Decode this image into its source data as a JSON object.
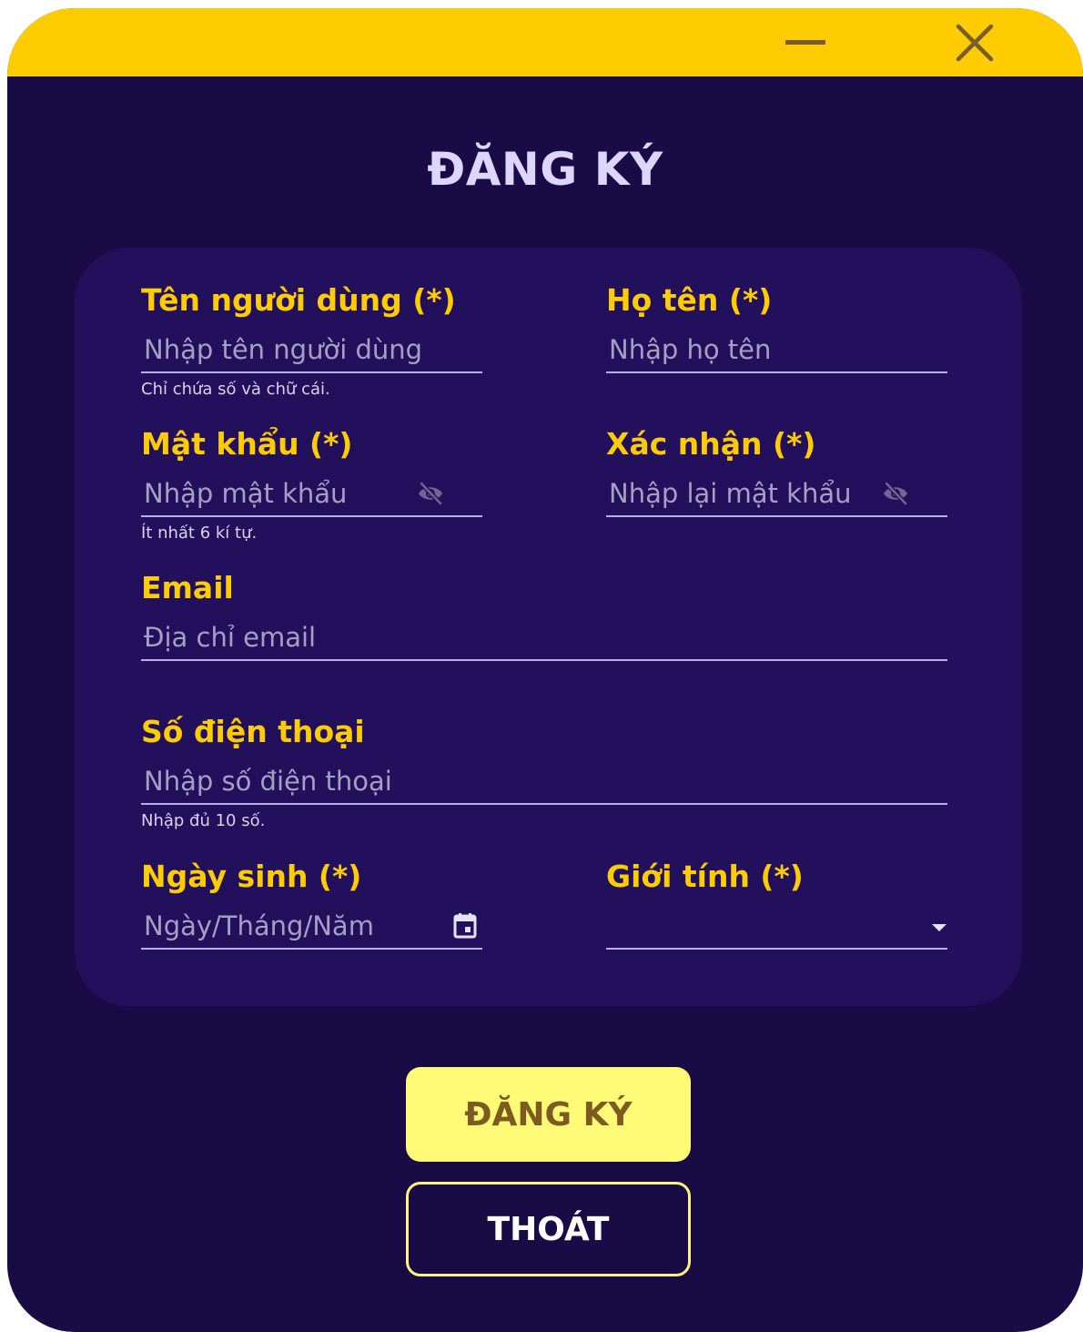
{
  "window": {
    "minimize_icon": "minimize-icon",
    "close_icon": "close-icon"
  },
  "form": {
    "title": "ĐĂNG KÝ",
    "username": {
      "label": "Tên người dùng (*)",
      "placeholder": "Nhập tên người dùng",
      "helper": "Chỉ chứa số và chữ cái."
    },
    "fullname": {
      "label": "Họ tên (*)",
      "placeholder": "Nhập họ tên"
    },
    "password": {
      "label": "Mật khẩu (*)",
      "placeholder": "Nhập mật khẩu",
      "helper": "Ít nhất 6 kí tự.",
      "icon": "eye-off-icon"
    },
    "confirm": {
      "label": "Xác nhận (*)",
      "placeholder": "Nhập lại mật khẩu",
      "icon": "eye-off-icon"
    },
    "email": {
      "label": "Email",
      "placeholder": "Địa chỉ email"
    },
    "phone": {
      "label": "Số điện thoại",
      "placeholder": "Nhập số điện thoại",
      "helper": "Nhập đủ 10 số."
    },
    "birthday": {
      "label": "Ngày sinh (*)",
      "placeholder": "Ngày/Tháng/Năm",
      "icon": "calendar-icon"
    },
    "gender": {
      "label": "Giới tính (*)",
      "value": "",
      "icon": "dropdown-arrow-icon"
    }
  },
  "actions": {
    "register_label": "ĐĂNG KÝ",
    "exit_label": "THOÁT"
  },
  "colors": {
    "background": "#190c46",
    "panel": "#23105c",
    "accent": "#fecc00",
    "heading": "#ddd6ff",
    "register_button": "#fffb77",
    "exit_border": "#fff37d"
  }
}
